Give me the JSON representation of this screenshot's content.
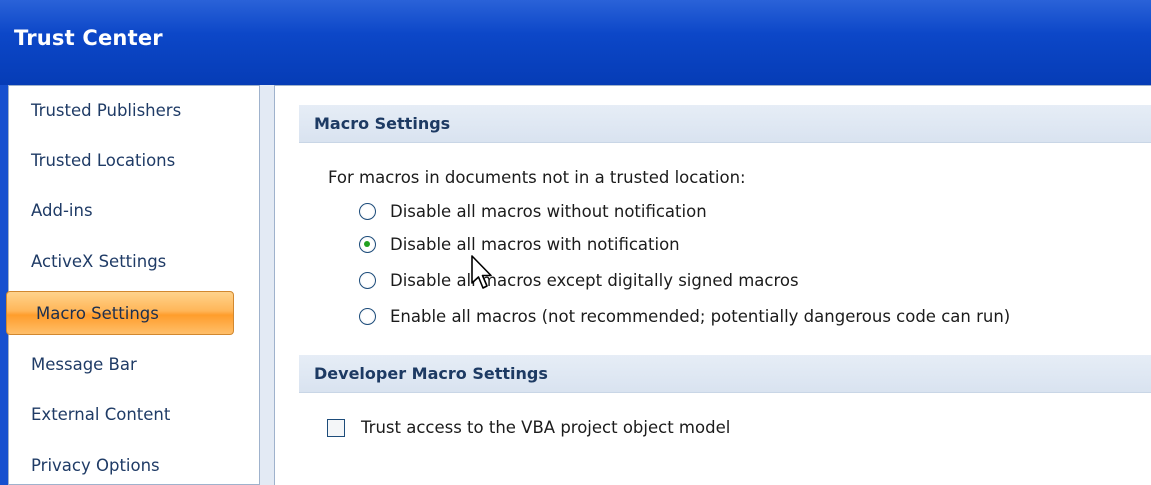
{
  "window": {
    "title": "Trust Center"
  },
  "sidebar": {
    "items": [
      {
        "label": "Trusted Publishers"
      },
      {
        "label": "Trusted Locations"
      },
      {
        "label": "Add-ins"
      },
      {
        "label": "ActiveX Settings"
      },
      {
        "label": "Macro Settings",
        "selected": true
      },
      {
        "label": "Message Bar"
      },
      {
        "label": "External Content"
      },
      {
        "label": "Privacy Options"
      }
    ]
  },
  "macro_settings": {
    "header": "Macro Settings",
    "intro": "For macros in documents not in a trusted location:",
    "options": [
      {
        "label": "Disable all macros without notification",
        "checked": false
      },
      {
        "label": "Disable all macros with notification",
        "checked": true
      },
      {
        "label": "Disable all macros except digitally signed macros",
        "checked": false
      },
      {
        "label": "Enable all macros (not recommended; potentially dangerous code can run)",
        "checked": false
      }
    ]
  },
  "developer_settings": {
    "header": "Developer Macro Settings",
    "vba_access_label": "Trust access to the VBA project object model",
    "vba_access_checked": false
  },
  "colors": {
    "titlebar": "#0c47c8",
    "selected_item": "#ffb658",
    "radio_dot": "#21a11f"
  }
}
